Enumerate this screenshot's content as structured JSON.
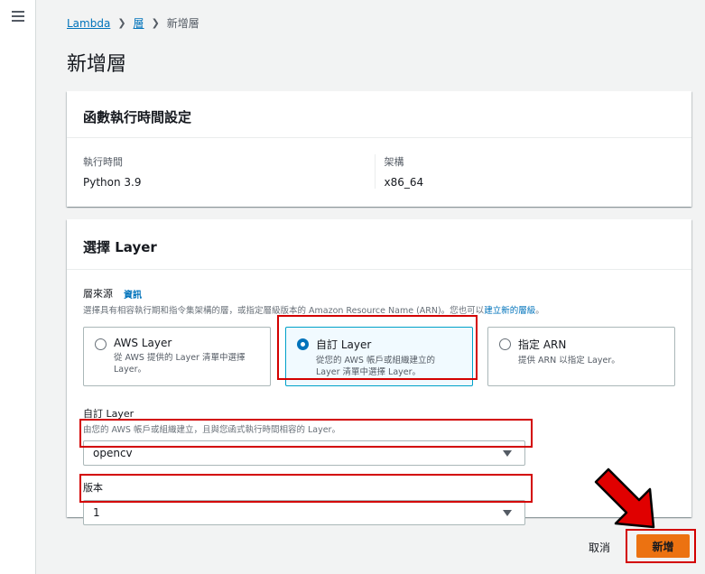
{
  "breadcrumb": {
    "root": "Lambda",
    "layers": "層",
    "current": "新增層"
  },
  "page": {
    "title": "新增層"
  },
  "runtime_panel": {
    "header": "函數執行時間設定",
    "runtime_label": "執行時間",
    "runtime_value": "Python 3.9",
    "arch_label": "架構",
    "arch_value": "x86_64"
  },
  "layer_panel": {
    "header": "選擇 Layer",
    "source_label": "層來源",
    "info_link": "資訊",
    "source_desc": "選擇具有相容執行期和指令集架構的層，或指定層級版本的 Amazon Resource Name (ARN)。您也可以",
    "source_desc_link": "建立新的層級",
    "source_desc_end": "。",
    "tiles": [
      {
        "title": "AWS Layer",
        "desc": "從 AWS 提供的 Layer 清單中選擇 Layer。",
        "selected": false
      },
      {
        "title": "自訂 Layer",
        "desc": "從您的 AWS 帳戶或組織建立的 Layer 清單中選擇 Layer。",
        "selected": true
      },
      {
        "title": "指定 ARN",
        "desc": "提供 ARN 以指定 Layer。",
        "selected": false
      }
    ],
    "custom_layer_label": "自訂 Layer",
    "custom_layer_desc": "由您的 AWS 帳戶或組織建立，且與您函式執行時間相容的 Layer。",
    "custom_layer_value": "opencv",
    "version_label": "版本",
    "version_value": "1"
  },
  "actions": {
    "cancel": "取消",
    "add": "新增"
  },
  "colors": {
    "primary_button": "#ec7211",
    "link": "#0073bb",
    "highlight": "#d30000"
  }
}
